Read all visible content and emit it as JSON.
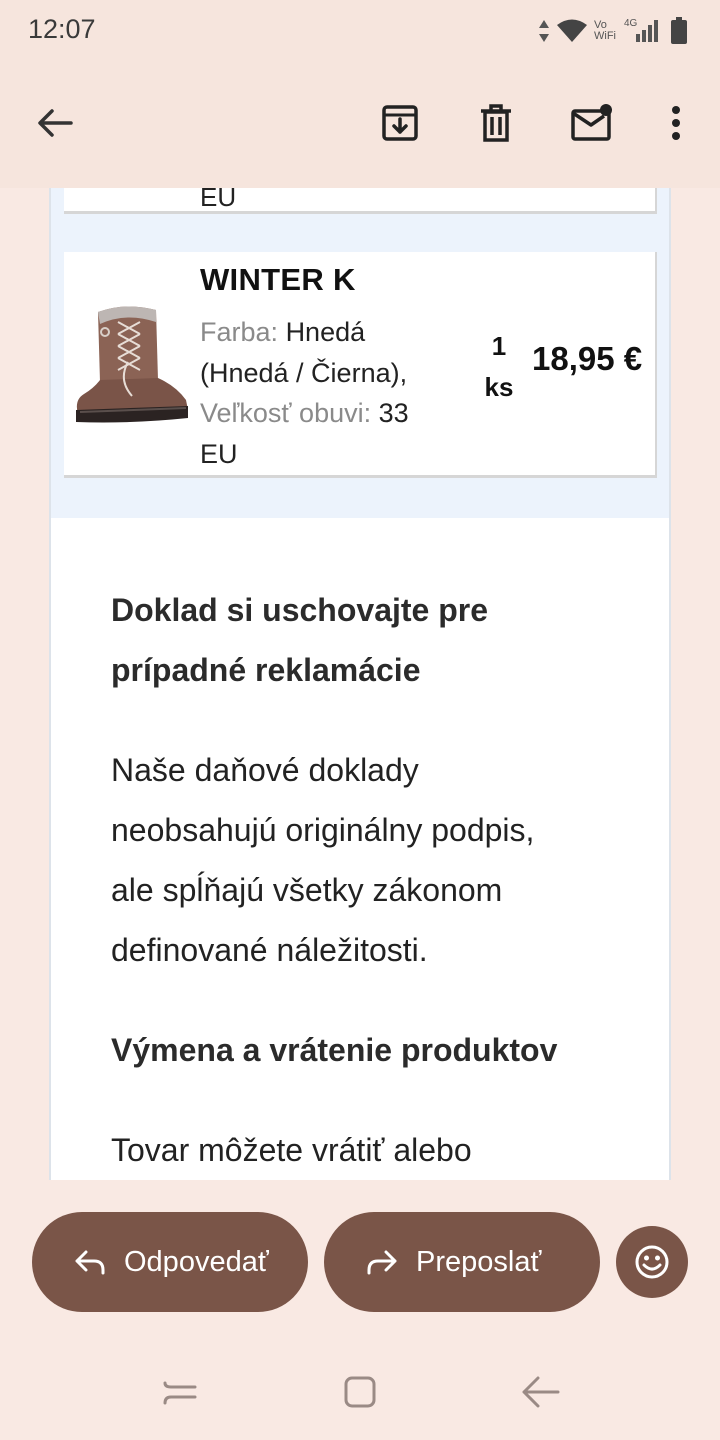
{
  "status_bar": {
    "time": "12:07",
    "icons": [
      "data-arrows-icon",
      "wifi-icon",
      "vowifi-icon",
      "4g-signal-icon",
      "battery-icon"
    ],
    "vowifi_top": "Vo",
    "vowifi_bottom": "WiFi",
    "network": "4G"
  },
  "toolbar": {
    "back_icon": "back-arrow-icon",
    "archive_icon": "archive-icon",
    "delete_icon": "trash-icon",
    "mark_unread_icon": "mark-unread-icon",
    "more_icon": "more-vert-icon"
  },
  "order": {
    "previous_item_tail": "EU",
    "item": {
      "name": "WINTER K",
      "color_label": "Farba:",
      "color_value": "Hnedá (Hnedá / Čierna),",
      "size_label": "Veľkosť obuvi:",
      "size_value": "33 EU",
      "qty_number": "1",
      "qty_unit": "ks",
      "price": "18,95 €"
    }
  },
  "sections": {
    "keep_receipt_heading": "Doklad si uschovajte pre prípadné reklamácie",
    "keep_receipt_text": "Naše daňové doklady neobsahujú originálny podpis, ale spĺňajú všetky zákonom definované náležitosti.",
    "exchange_heading": "Výmena a vrátenie produktov",
    "exchange_text": "Tovar môžete vrátiť alebo"
  },
  "actions": {
    "reply_label": "Odpovedať",
    "forward_label": "Preposlať",
    "emoji_icon": "emoji-reaction-icon"
  },
  "colors": {
    "status_bg": "#f6e5dd",
    "action_brown": "#7a5548",
    "items_band": "#ecf3fc"
  }
}
